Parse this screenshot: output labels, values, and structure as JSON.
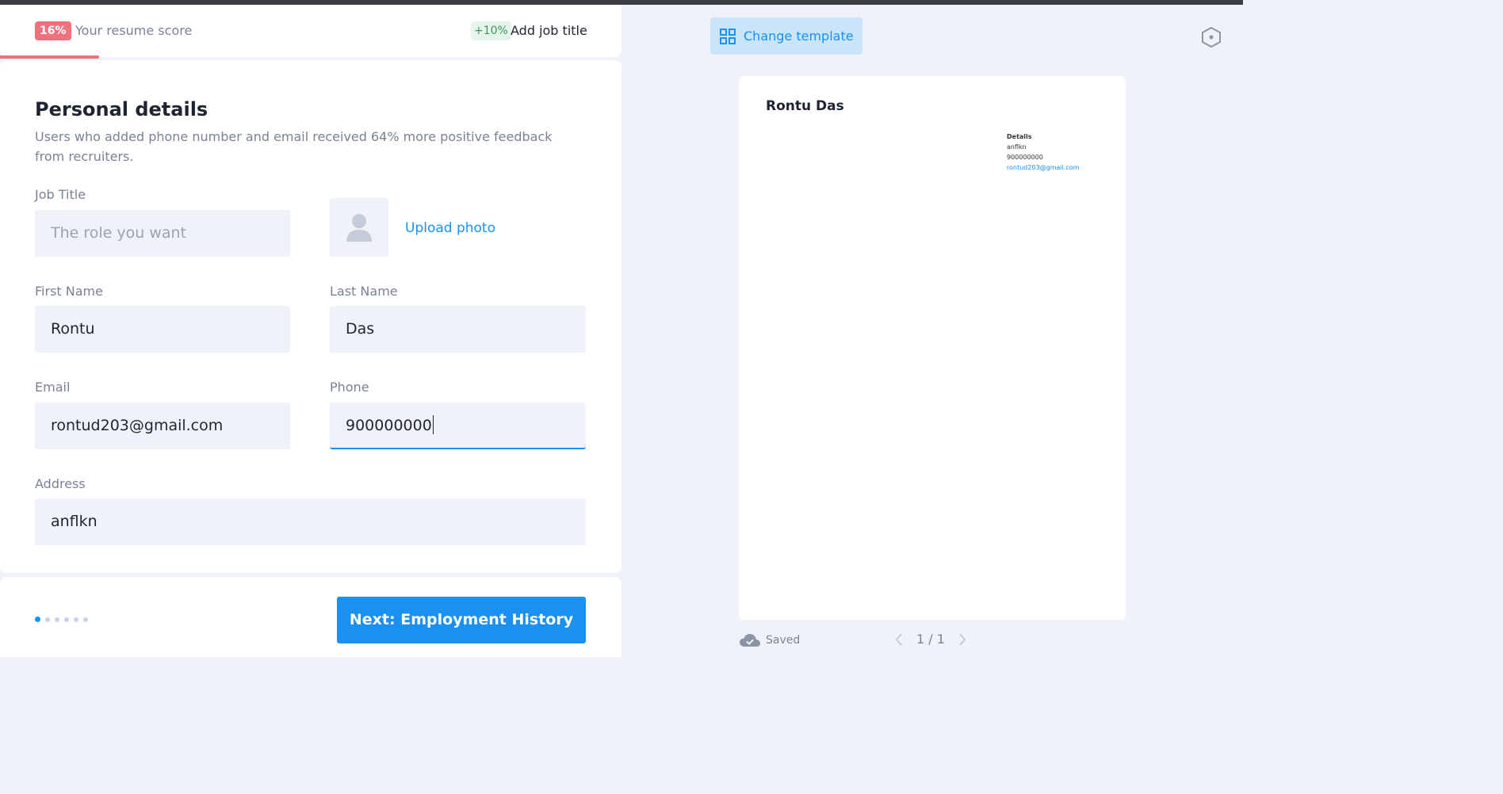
{
  "score": {
    "percent_label": "16%",
    "label": "Your resume score",
    "bonus_label": "+10%",
    "bonus_action": "Add job title",
    "progress_fraction": 0.16
  },
  "form": {
    "title": "Personal details",
    "description": "Users who added phone number and email received 64% more positive feedback from recruiters.",
    "job_title": {
      "label": "Job Title",
      "value": "",
      "placeholder": "The role you want"
    },
    "upload_photo_label": "Upload photo",
    "first_name": {
      "label": "First Name",
      "value": "Rontu"
    },
    "last_name": {
      "label": "Last Name",
      "value": "Das"
    },
    "email": {
      "label": "Email",
      "value": "rontud203@gmail.com"
    },
    "phone": {
      "label": "Phone",
      "value": "900000000"
    },
    "address": {
      "label": "Address",
      "value": "anflkn"
    }
  },
  "footer": {
    "step_count": 6,
    "current_step": 1,
    "next_label": "Next: Employment History"
  },
  "preview": {
    "change_template_label": "Change template",
    "resume_name": "Rontu Das",
    "details_heading": "Details",
    "details_address": "anflkn",
    "details_phone": "900000000",
    "details_email": "rontud203@gmail.com",
    "saved_label": "Saved",
    "page_indicator": "1 / 1"
  },
  "icons": {
    "change_template": "grid-icon",
    "settings": "hexagon-settings-icon",
    "avatar_placeholder": "person-icon",
    "saved": "cloud-check-icon",
    "prev_page": "chevron-left-icon",
    "next_page": "chevron-right-icon"
  },
  "colors": {
    "accent": "#1a91f0",
    "score": "#f0717e",
    "bonus": "#339d5d",
    "field_bg": "#eff2f9"
  }
}
